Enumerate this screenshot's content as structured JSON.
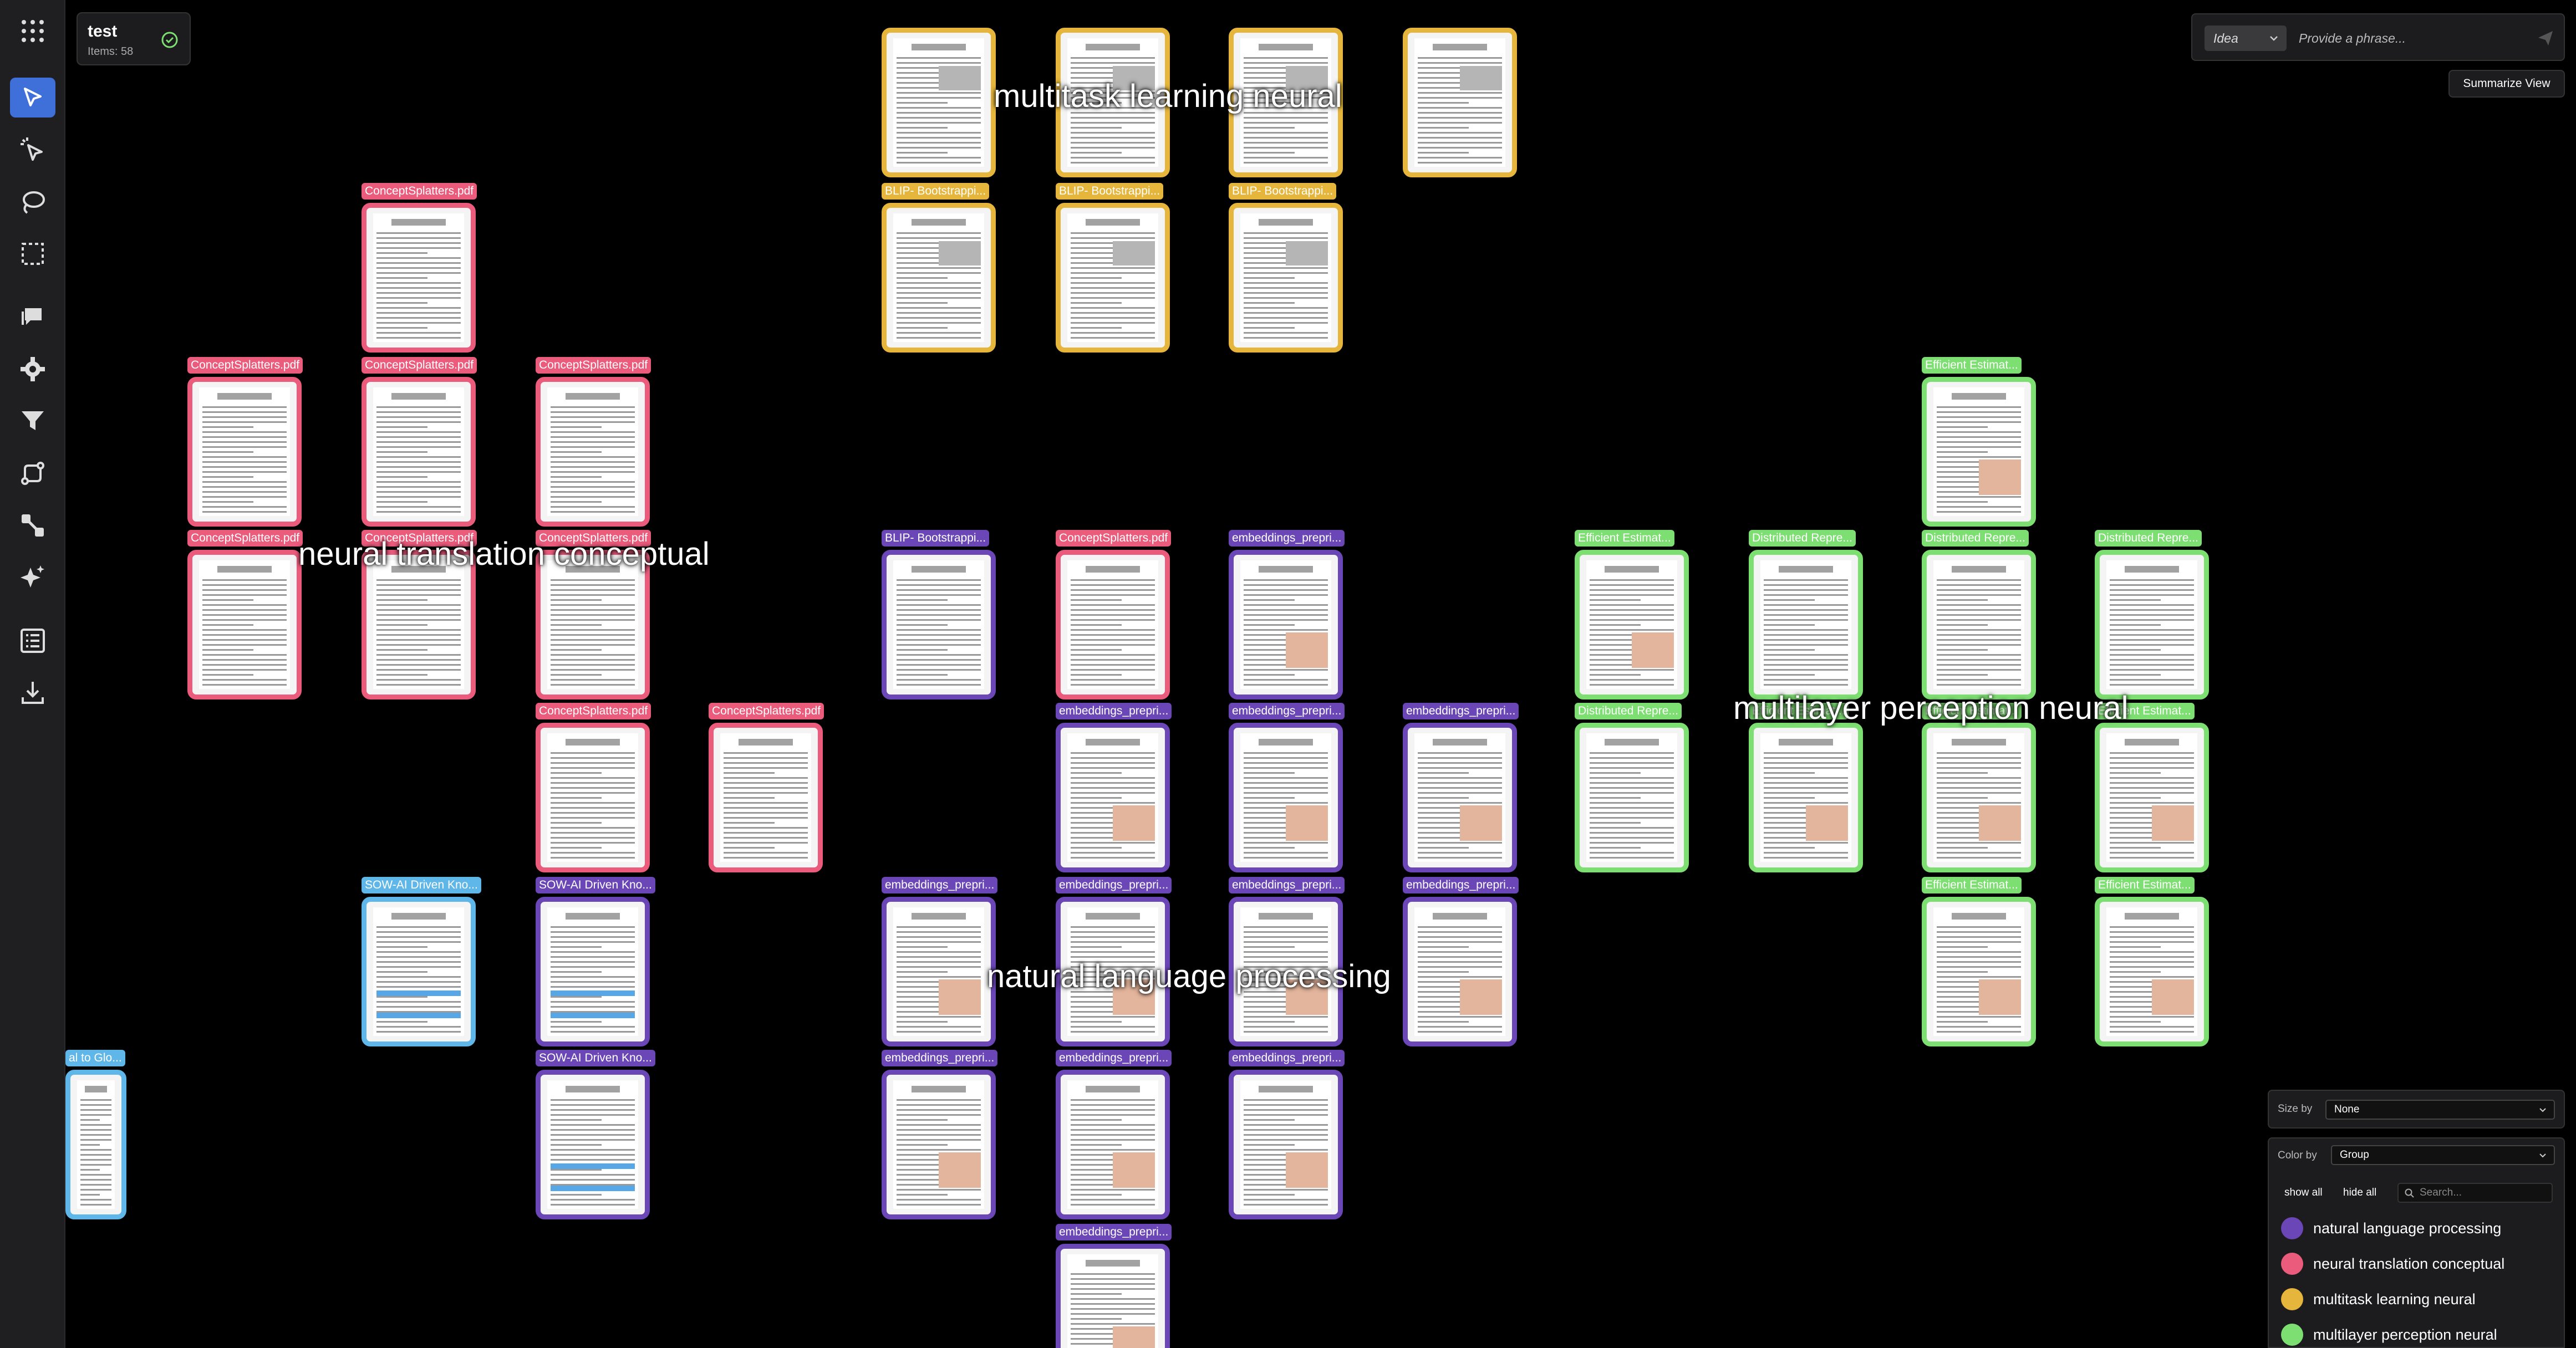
{
  "project": {
    "name": "test",
    "items": "Items: 58"
  },
  "toolbar": {
    "tools": [
      {
        "name": "select-tool-icon",
        "top": 0
      },
      {
        "name": "magic-select-icon"
      },
      {
        "name": "lasso-icon"
      },
      {
        "name": "marquee-select-icon"
      },
      {
        "name": "comment-icon"
      },
      {
        "name": "settings-icon"
      },
      {
        "name": "filter-icon"
      },
      {
        "name": "path-icon"
      },
      {
        "name": "connect-icon"
      },
      {
        "name": "sparkle-icon"
      },
      {
        "name": "list-icon"
      },
      {
        "name": "download-icon"
      }
    ]
  },
  "search": {
    "mode": "Idea",
    "placeholder": "Provide a phrase..."
  },
  "summarize_label": "Summarize View",
  "size_by": {
    "label": "Size by",
    "value": "None"
  },
  "color_by": {
    "label": "Color by",
    "value": "Group"
  },
  "show_all": "show all",
  "hide_all": "hide all",
  "group_search_placeholder": "Search...",
  "colors": {
    "pink": "#ea5b7c",
    "yellow": "#e5b53c",
    "green": "#7dde72",
    "purple": "#6a46b6",
    "blue": "#5fb6e8"
  },
  "legend": [
    {
      "name": "natural language processing",
      "color": "#6a46b6"
    },
    {
      "name": "neural translation conceptual",
      "color": "#ea5b7c"
    },
    {
      "name": "multitask learning neural",
      "color": "#e5b53c"
    },
    {
      "name": "multilayer perception neural",
      "color": "#7dde72"
    }
  ],
  "clusters": [
    {
      "label": "multitask learning neural"
    },
    {
      "label": "neural translation conceptual"
    },
    {
      "label": "multilayer perception neural"
    },
    {
      "label": "natural language processing"
    }
  ],
  "cards": [
    {
      "color": "yellow",
      "label": ""
    },
    {
      "color": "yellow",
      "label": ""
    },
    {
      "color": "yellow",
      "label": ""
    },
    {
      "color": "yellow",
      "label": ""
    },
    {
      "color": "yellow",
      "label": "BLIP- Bootstrappi..."
    },
    {
      "color": "yellow",
      "label": "BLIP- Bootstrappi..."
    },
    {
      "color": "yellow",
      "label": "BLIP- Bootstrappi..."
    },
    {
      "color": "pink",
      "label": "ConceptSplatters.pdf"
    },
    {
      "color": "pink",
      "label": "ConceptSplatters.pdf"
    },
    {
      "color": "pink",
      "label": "ConceptSplatters.pdf"
    },
    {
      "color": "pink",
      "label": "ConceptSplatters.pdf"
    },
    {
      "color": "pink",
      "label": "ConceptSplatters.pdf"
    },
    {
      "color": "pink",
      "label": "ConceptSplatters.pdf"
    },
    {
      "color": "pink",
      "label": "ConceptSplatters.pdf"
    },
    {
      "color": "pink",
      "label": "ConceptSplatters.pdf"
    },
    {
      "color": "pink",
      "label": "ConceptSplatters.pdf"
    },
    {
      "color": "blue",
      "label": "SOW-AI Driven Kno..."
    },
    {
      "color": "purple",
      "label": "SOW-AI Driven Kno..."
    },
    {
      "color": "purple",
      "label": "SOW-AI Driven Kno..."
    },
    {
      "color": "blue",
      "label": "al to Glo..."
    },
    {
      "color": "purple",
      "label": "BLIP- Bootstrappi..."
    },
    {
      "color": "pink",
      "label": "ConceptSplatters.pdf"
    },
    {
      "color": "purple",
      "label": "embeddings_prepri..."
    },
    {
      "color": "purple",
      "label": "embeddings_prepri..."
    },
    {
      "color": "purple",
      "label": "embeddings_prepri..."
    },
    {
      "color": "purple",
      "label": "embeddings_prepri..."
    },
    {
      "color": "purple",
      "label": "embeddings_prepri..."
    },
    {
      "color": "purple",
      "label": "embeddings_prepri..."
    },
    {
      "color": "purple",
      "label": "embeddings_prepri..."
    },
    {
      "color": "purple",
      "label": "embeddings_prepri..."
    },
    {
      "color": "purple",
      "label": "embeddings_prepri..."
    },
    {
      "color": "purple",
      "label": "embeddings_prepri..."
    },
    {
      "color": "purple",
      "label": "embeddings_prepri..."
    },
    {
      "color": "purple",
      "label": "embeddings_prepri..."
    },
    {
      "color": "green",
      "label": "Efficient Estimat..."
    },
    {
      "color": "green",
      "label": "Efficient Estimat..."
    },
    {
      "color": "green",
      "label": "Distributed Repre..."
    },
    {
      "color": "green",
      "label": "Distributed Repre..."
    },
    {
      "color": "green",
      "label": "Distributed Repre..."
    },
    {
      "color": "green",
      "label": "Distributed Repre..."
    },
    {
      "color": "green",
      "label": "Efficient Estimat..."
    },
    {
      "color": "green",
      "label": "Efficient Estimat..."
    },
    {
      "color": "green",
      "label": "Efficient Estimat..."
    },
    {
      "color": "green",
      "label": "Efficient Estimat..."
    },
    {
      "color": "green",
      "label": "Efficient Estimat..."
    }
  ]
}
